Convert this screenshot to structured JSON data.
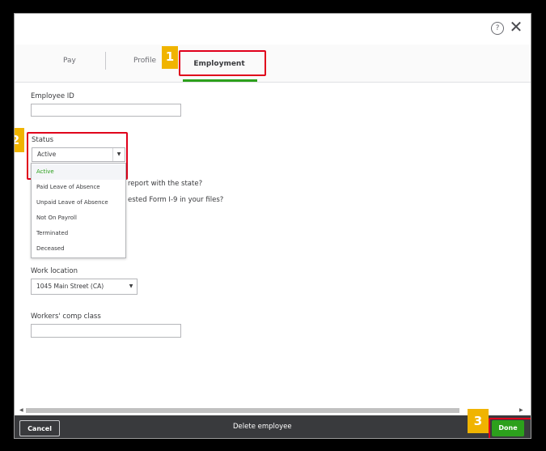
{
  "topbar": {
    "help_icon": "?",
    "close_icon": "✕"
  },
  "tabs": [
    {
      "label": "Pay"
    },
    {
      "label": "Profile"
    },
    {
      "label": "Employment",
      "active": true
    }
  ],
  "annotations": [
    "1",
    "2",
    "3"
  ],
  "employee_id": {
    "label": "Employee ID",
    "value": ""
  },
  "status": {
    "label": "Status",
    "selected": "Active",
    "options": [
      "Active",
      "Paid Leave of Absence",
      "Unpaid Leave of Absence",
      "Not On Payroll",
      "Terminated",
      "Deceased"
    ]
  },
  "questions": {
    "q1": "report with the state?",
    "q2": "ested Form I-9 in your files?"
  },
  "work_location": {
    "label": "Work location",
    "selected": "1045 Main Street (CA)"
  },
  "workers_comp": {
    "label": "Workers' comp class",
    "value": ""
  },
  "footer": {
    "cancel_label": "Cancel",
    "delete_label": "Delete employee",
    "done_label": "Done"
  },
  "colors": {
    "accent": "#2ca01c",
    "footer_bg": "#393a3d",
    "annotation": "#f0b400",
    "highlight": "#e0001b"
  }
}
